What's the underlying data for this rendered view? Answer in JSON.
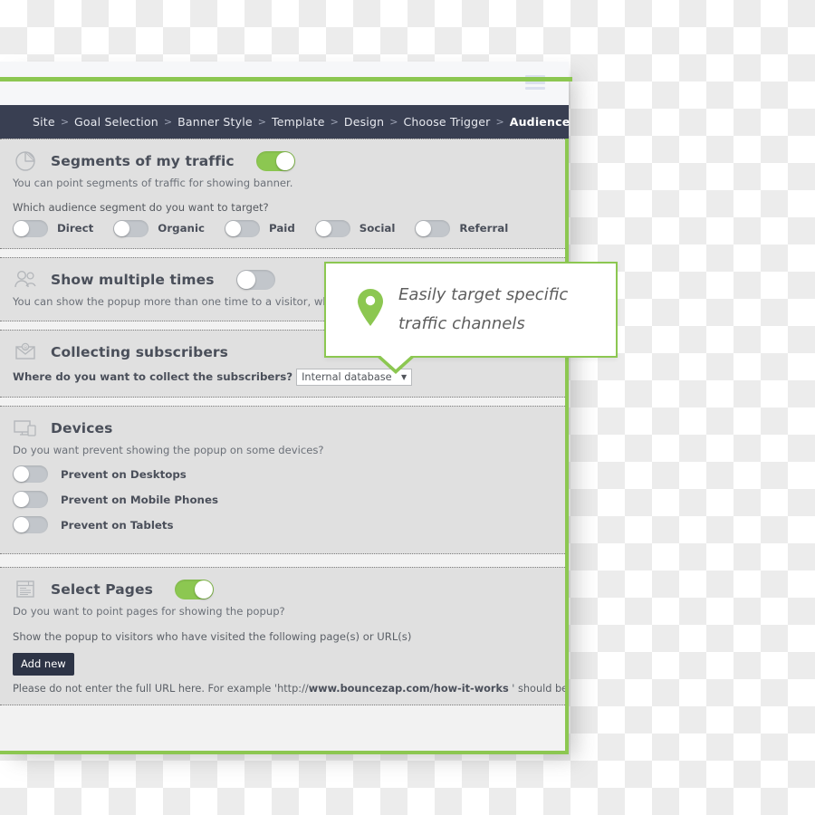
{
  "theme": {
    "accent_green": "#8cc751",
    "dark_navy": "#393f52",
    "button_dark": "#2d3446",
    "section_bg": "#e0e0e0",
    "page_bg": "#f2f2f2"
  },
  "topbar": {
    "menu_icon": "hamburger-menu-icon"
  },
  "breadcrumb": {
    "items": [
      {
        "label": "Site",
        "active": false
      },
      {
        "label": "Goal Selection",
        "active": false
      },
      {
        "label": "Banner Style",
        "active": false
      },
      {
        "label": "Template",
        "active": false
      },
      {
        "label": "Design",
        "active": false
      },
      {
        "label": "Choose Trigger",
        "active": false
      },
      {
        "label": "Audience",
        "active": true
      }
    ],
    "separator": ">"
  },
  "sections": {
    "segments": {
      "icon": "pie-chart-icon",
      "title": "Segments of my traffic",
      "toggle_state": "on",
      "description": "You can point segments of traffic for showing banner.",
      "question": "Which audience segment do you want to target?",
      "options": [
        {
          "label": "Direct",
          "state": "off"
        },
        {
          "label": "Organic",
          "state": "off"
        },
        {
          "label": "Paid",
          "state": "off"
        },
        {
          "label": "Social",
          "state": "off"
        },
        {
          "label": "Referral",
          "state": "off"
        }
      ]
    },
    "multiple_times": {
      "icon": "users-icon",
      "title": "Show multiple times",
      "toggle_state": "off",
      "description": "You can show the popup more than one time to a visitor, which did not see it earlier."
    },
    "collecting": {
      "icon": "envelope-icon",
      "title": "Collecting subscribers",
      "question": "Where do you want to collect the subscribers?",
      "select_value": "Internal database",
      "select_arrow": "▼"
    },
    "devices": {
      "icon": "devices-icon",
      "title": "Devices",
      "description": "Do you want prevent showing the popup on some devices?",
      "options": [
        {
          "label": "Prevent on Desktops",
          "state": "off"
        },
        {
          "label": "Prevent on Mobile Phones",
          "state": "off"
        },
        {
          "label": "Prevent on Tablets",
          "state": "off"
        }
      ]
    },
    "select_pages": {
      "icon": "webpage-icon",
      "title": "Select Pages",
      "toggle_state": "on",
      "description": "Do you want to point pages for showing the popup?",
      "instruction": "Show the popup to visitors who have visited the following page(s) or URL(s)",
      "add_button": "Add new",
      "note_prefix": "Please do not enter the full URL here. For example 'http://",
      "note_bold": "www.bouncezap.com/how-it-works",
      "note_suffix": " ' should be entered as"
    }
  },
  "tooltip": {
    "icon": "map-pin-icon",
    "line1": "Easily target specific",
    "line2": "traffic channels"
  }
}
